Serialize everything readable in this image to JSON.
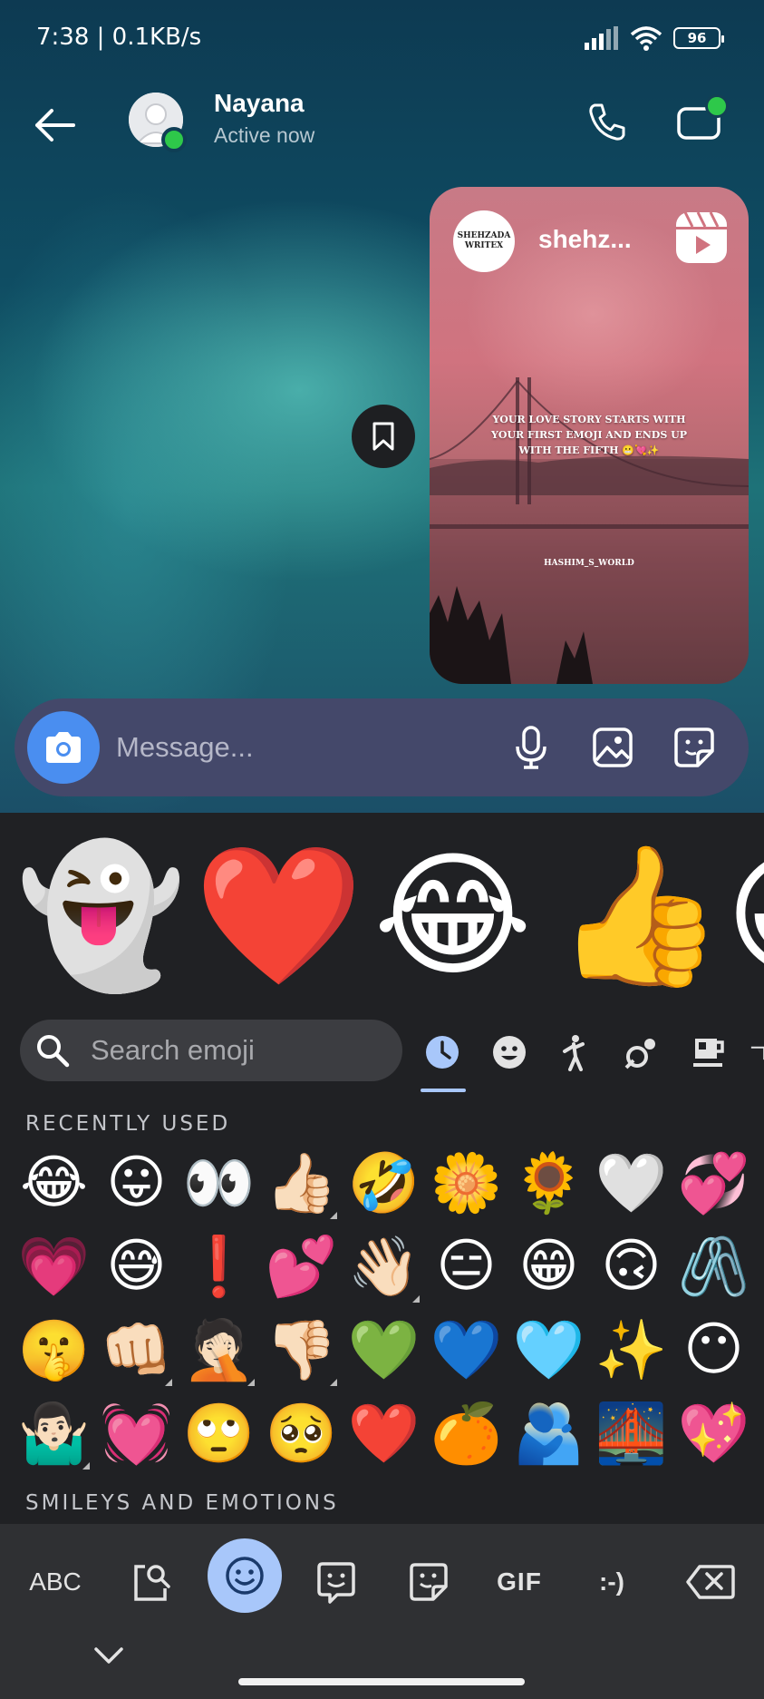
{
  "status_bar": {
    "time": "7:38 | 0.1KB/s",
    "battery": "96"
  },
  "header": {
    "contact_name": "Nayana",
    "contact_status": "Active now"
  },
  "reel": {
    "author_avatar_text": "SHEHZADA WRITEX",
    "author_name": "shehz...",
    "caption": "YOUR LOVE STORY STARTS WITH YOUR FIRST EMOJI AND ENDS UP WITH THE FIFTH 😬💘✨",
    "watermark": "HASHIM_S_WORLD"
  },
  "composer": {
    "placeholder": "Message..."
  },
  "keyboard": {
    "suggestions": [
      "👻",
      "❤️",
      "😂",
      "👍",
      "😀"
    ],
    "search_placeholder": "Search emoji",
    "categories": [
      "recent",
      "smileys",
      "people",
      "activities",
      "food",
      "objects"
    ],
    "recently_used_label": "RECENTLY USED",
    "smileys_label": "SMILEYS AND EMOTIONS",
    "recent_rows": [
      [
        "😂",
        "😛",
        "👀",
        "👍🏻",
        "🤣",
        "🌼",
        "🌻",
        "🤍",
        "💞"
      ],
      [
        "💗",
        "😅",
        "❗",
        "💕",
        "👋🏻",
        "😑",
        "😁",
        "🙃",
        "🖇️"
      ],
      [
        "🤫",
        "👊🏻",
        "🤦🏻",
        "👎🏻",
        "💚",
        "💙",
        "🩵",
        "✨",
        "😶"
      ],
      [
        "🤷🏻‍♂️",
        "💓",
        "🙄",
        "🥺",
        "❤️",
        "🍊",
        "🫂",
        "🌉",
        "💖"
      ]
    ],
    "toolbar": {
      "abc": "ABC",
      "gif": "GIF",
      "emoticon": ":-)"
    }
  }
}
